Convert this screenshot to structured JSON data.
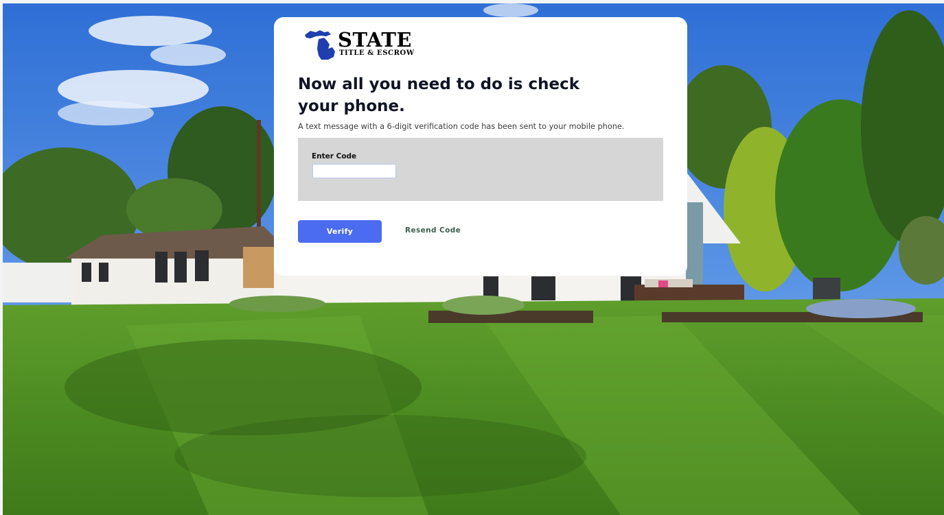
{
  "brand": {
    "name": "STATE",
    "tagline": "TITLE & ESCROW",
    "logo_icon": "michigan-map-icon",
    "logo_color": "#1f3fae"
  },
  "verification": {
    "headline": "Now all you need to do is check your phone.",
    "instructions": "A text message with a 6-digit verification code has been sent to your mobile phone.",
    "code_label": "Enter Code",
    "code_value": "",
    "verify_label": "Verify",
    "resend_label": "Resend Code"
  },
  "colors": {
    "primary_button": "#4b6cf1",
    "resend_link": "#3c5e4f",
    "code_panel": "#d6d6d6",
    "card": "#ffffff"
  }
}
